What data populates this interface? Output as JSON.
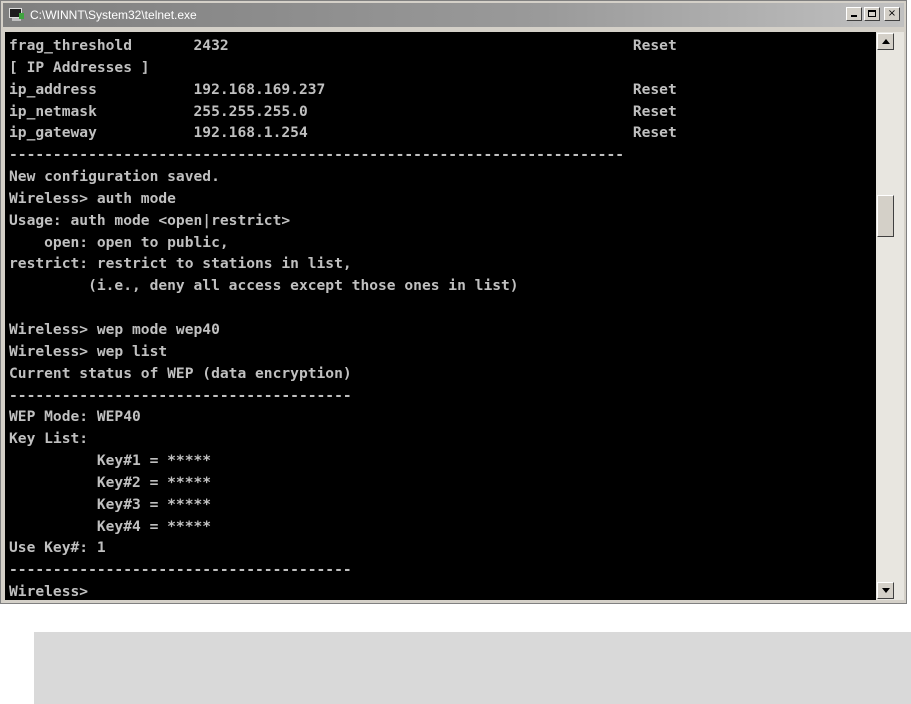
{
  "window": {
    "title": "C:\\WINNT\\System32\\telnet.exe",
    "buttons": {
      "minimize": "_",
      "maximize": "□",
      "close": "×"
    }
  },
  "console": {
    "lines": [
      "frag_threshold       2432                                              Reset",
      "[ IP Addresses ]",
      "ip_address           192.168.169.237                                   Reset",
      "ip_netmask           255.255.255.0                                     Reset",
      "ip_gateway           192.168.1.254                                     Reset",
      "----------------------------------------------------------------------",
      "New configuration saved.",
      "Wireless> auth mode",
      "Usage: auth mode <open|restrict>",
      "    open: open to public,",
      "restrict: restrict to stations in list,",
      "         (i.e., deny all access except those ones in list)",
      "",
      "Wireless> wep mode wep40",
      "Wireless> wep list",
      "Current status of WEP (data encryption)",
      "---------------------------------------",
      "WEP Mode: WEP40",
      "Key List:",
      "          Key#1 = *****",
      "          Key#2 = *****",
      "          Key#3 = *****",
      "          Key#4 = *****",
      "Use Key#: 1",
      "---------------------------------------",
      "Wireless>"
    ]
  },
  "colors": {
    "console_bg": "#000000",
    "console_text": "#c0c0c0",
    "titlebar": "#8c8c8c",
    "window_frame": "#d4d0c8"
  }
}
